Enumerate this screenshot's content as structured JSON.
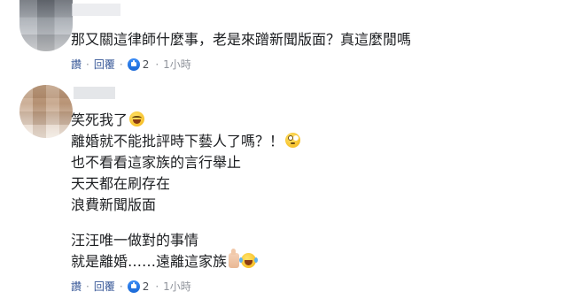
{
  "comments": [
    {
      "text_lines": [
        "那又關這律師什麼事，老是來蹭新聞版面？真這麼閒嗎"
      ],
      "actions": {
        "like_label": "讚",
        "reply_label": "回覆",
        "reaction_count": "2",
        "time": "1小時"
      }
    },
    {
      "text_lines": [
        "笑死我了",
        "離婚就不能批評時下藝人了嗎？！",
        "也不看看這家族的言行舉止",
        "天天都在刷存在",
        "浪費新聞版面",
        "汪汪唯一做對的事情",
        "就是離婚……遠離這家族"
      ],
      "actions": {
        "like_label": "讚",
        "reply_label": "回覆",
        "reaction_count": "2",
        "time": "1小時"
      }
    }
  ],
  "icons": {
    "reaction": "like-icon",
    "emoji_1": "grinning-squinting-face-icon",
    "emoji_2": "face-with-rolling-eyes-icon",
    "emoji_3": "thumbs-up-icon",
    "emoji_4": "face-with-tears-of-joy-icon"
  },
  "colors": {
    "link": "#385898",
    "text": "#1c1e21",
    "meta": "#90949c",
    "like_blue": "#1968d6"
  }
}
